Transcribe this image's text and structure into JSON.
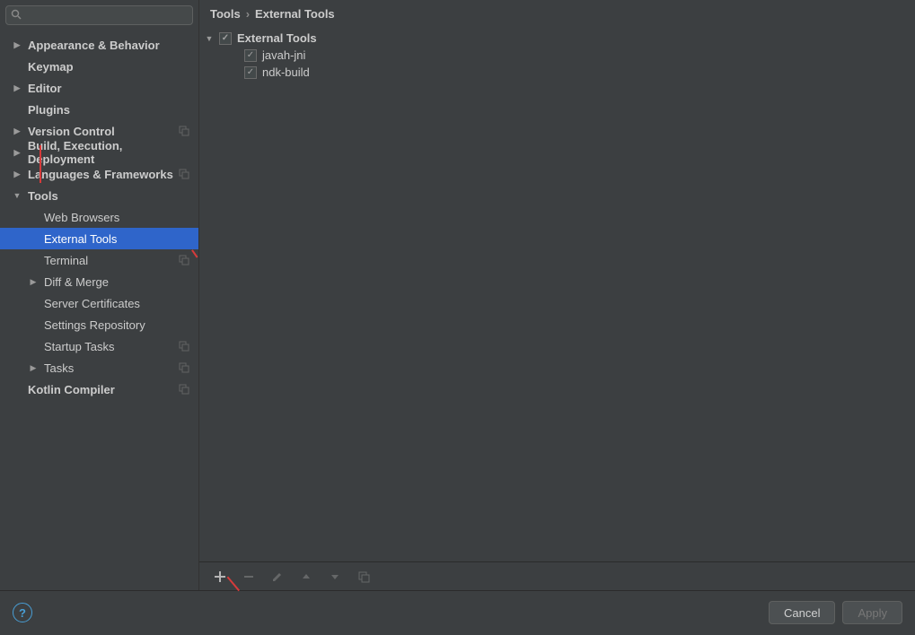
{
  "search": {
    "placeholder": ""
  },
  "sidebar": {
    "items": [
      {
        "label": "Appearance & Behavior",
        "arrow": "right",
        "indent": 0
      },
      {
        "label": "Keymap",
        "arrow": "",
        "indent": 0
      },
      {
        "label": "Editor",
        "arrow": "right",
        "indent": 0
      },
      {
        "label": "Plugins",
        "arrow": "",
        "indent": 0
      },
      {
        "label": "Version Control",
        "arrow": "right",
        "indent": 0,
        "copy": true
      },
      {
        "label": "Build, Execution, Deployment",
        "arrow": "right",
        "indent": 0
      },
      {
        "label": "Languages & Frameworks",
        "arrow": "right",
        "indent": 0,
        "copy": true
      },
      {
        "label": "Tools",
        "arrow": "down",
        "indent": 0
      },
      {
        "label": "Web Browsers",
        "arrow": "",
        "indent": 1
      },
      {
        "label": "External Tools",
        "arrow": "",
        "indent": 1,
        "selected": true
      },
      {
        "label": "Terminal",
        "arrow": "",
        "indent": 1,
        "copy": true
      },
      {
        "label": "Diff & Merge",
        "arrow": "right",
        "indent": 1
      },
      {
        "label": "Server Certificates",
        "arrow": "",
        "indent": 1
      },
      {
        "label": "Settings Repository",
        "arrow": "",
        "indent": 1
      },
      {
        "label": "Startup Tasks",
        "arrow": "",
        "indent": 1,
        "copy": true
      },
      {
        "label": "Tasks",
        "arrow": "right",
        "indent": 1,
        "copy": true
      },
      {
        "label": "Kotlin Compiler",
        "arrow": "",
        "indent": 0,
        "copy": true
      }
    ]
  },
  "breadcrumb": {
    "part1": "Tools",
    "part2": "External Tools"
  },
  "tools_tree": {
    "root": "External Tools",
    "children": [
      {
        "label": "javah-jni"
      },
      {
        "label": "ndk-build"
      }
    ]
  },
  "buttons": {
    "cancel": "Cancel",
    "apply": "Apply"
  }
}
